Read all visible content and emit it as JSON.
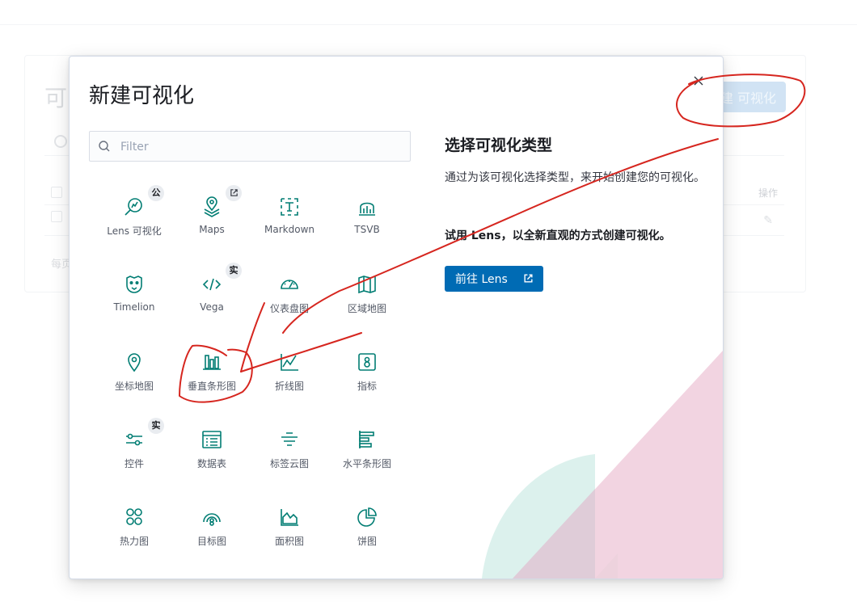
{
  "background": {
    "page_title_fragment": "可",
    "create_button_label": "建 可视化",
    "actions_column_label": "操作",
    "footer_fragment": "每页"
  },
  "modal": {
    "title": "新建可视化",
    "filter_placeholder": "Filter",
    "tiles": [
      {
        "label": "Lens 可视化",
        "icon": "lens-icon",
        "badge": "公"
      },
      {
        "label": "Maps",
        "icon": "maps-icon",
        "badge_icon": "external-link-icon"
      },
      {
        "label": "Markdown",
        "icon": "markdown-icon"
      },
      {
        "label": "TSVB",
        "icon": "tsvb-icon"
      },
      {
        "label": "Timelion",
        "icon": "timelion-icon"
      },
      {
        "label": "Vega",
        "icon": "vega-icon",
        "badge": "实"
      },
      {
        "label": "仪表盘图",
        "icon": "gauge-icon"
      },
      {
        "label": "区域地图",
        "icon": "region-map-icon"
      },
      {
        "label": "坐标地图",
        "icon": "coordinate-map-icon"
      },
      {
        "label": "垂直条形图",
        "icon": "vertical-bar-icon"
      },
      {
        "label": "折线图",
        "icon": "line-chart-icon"
      },
      {
        "label": "指标",
        "icon": "metric-icon"
      },
      {
        "label": "控件",
        "icon": "controls-icon",
        "badge": "实"
      },
      {
        "label": "数据表",
        "icon": "data-table-icon"
      },
      {
        "label": "标签云图",
        "icon": "tag-cloud-icon"
      },
      {
        "label": "水平条形图",
        "icon": "horizontal-bar-icon"
      },
      {
        "label": "热力图",
        "icon": "heatmap-icon"
      },
      {
        "label": "目标图",
        "icon": "goal-icon"
      },
      {
        "label": "面积图",
        "icon": "area-chart-icon"
      },
      {
        "label": "饼图",
        "icon": "pie-chart-icon"
      }
    ],
    "side": {
      "title": "选择可视化类型",
      "description": "通过为该可视化选择类型，来开始创建您的可视化。",
      "try_lens": "试用 Lens，以全新直观的方式创建可视化。",
      "lens_button_label": "前往 Lens"
    }
  },
  "colors": {
    "accent": "#006bb4",
    "icon": "#017d73",
    "annotation": "#d6261f",
    "deco_pink": "#f1d3e0",
    "deco_teal": "#d9f0ec"
  }
}
